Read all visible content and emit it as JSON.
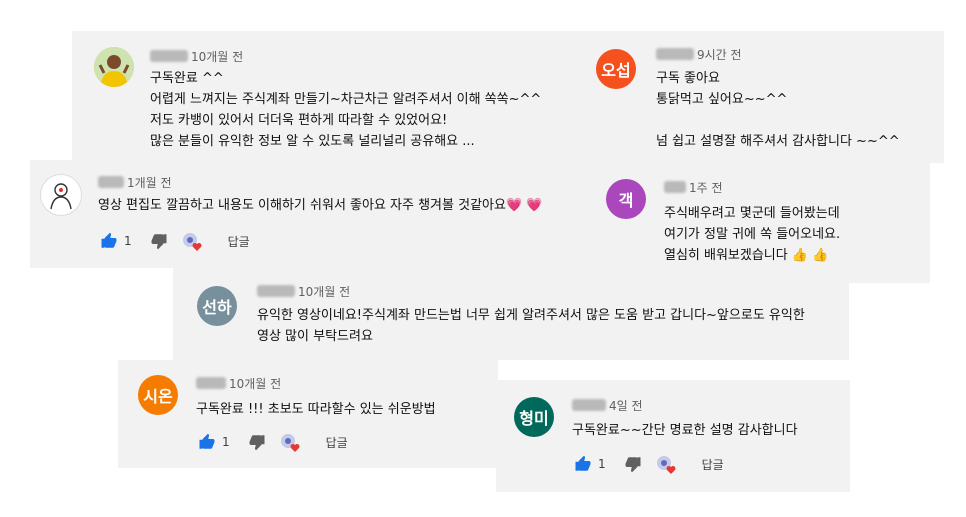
{
  "comments": [
    {
      "avatar_text": "",
      "avatar_color": "#f0c419",
      "time": "10개월 전",
      "lines": [
        "구독완료  ^^",
        "어렵게 느껴지는 주식계좌 만들기~차근차근 알려주셔서 이해 쏙쏙~^^",
        "저도 카뱅이 있어서 더더욱 편하게 따라할 수 있었어요!",
        "많은 분들이 유익한 정보 알 수 있도록 널리널리 공유해요 ..."
      ]
    },
    {
      "avatar_text": "오섭",
      "avatar_color": "#f4511e",
      "time": "9시간 전",
      "lines": [
        "구독 좋아요",
        "통닭먹고 싶어요~~^^",
        "",
        "넘 쉽고 설명잘  해주셔서 감사합니다 ~~^^"
      ]
    },
    {
      "avatar_text": "",
      "avatar_color": "#ffffff",
      "time": "1개월 전",
      "lines": [
        "영상 편집도 깔끔하고 내용도 이해하기 쉬워서 좋아요 자주 챙겨볼 것같아요💗 💗"
      ],
      "likes": "1",
      "reply_label": "답글"
    },
    {
      "avatar_text": "객",
      "avatar_color": "#ab47bc",
      "time": "1주 전",
      "lines": [
        "주식배우려고 몇군데 들어봤는데",
        "여기가 정말 귀에 쏙 들어오네요.",
        "열심히 배워보겠습니다 👍 👍"
      ]
    },
    {
      "avatar_text": "선하",
      "avatar_color": "#78909c",
      "time": "10개월 전",
      "lines": [
        "유익한 영상이네요!주식계좌 만드는법 너무 쉽게 알려주셔서 많은 도움 받고 갑니다~앞으로도 유익한",
        "영상 많이 부탁드려요"
      ]
    },
    {
      "avatar_text": "시온",
      "avatar_color": "#f57c00",
      "time": "10개월 전",
      "lines": [
        "구독완료 !!!  초보도  따라할수 있는  쉬운방법"
      ],
      "likes": "1",
      "reply_label": "답글"
    },
    {
      "avatar_text": "형미",
      "avatar_color": "#00695c",
      "time": "4일 전",
      "lines": [
        "구독완료~~간단 명료한 설명 감사합니다"
      ],
      "likes": "1",
      "reply_label": "답글"
    }
  ],
  "colors": {
    "card_bg": "#f2f2f2",
    "like_blue": "#1a73e8",
    "heart_red": "#e53935",
    "text_secondary": "#606060"
  },
  "icons": [
    "thumb-up-icon",
    "thumb-down-icon",
    "creator-heart-icon"
  ]
}
